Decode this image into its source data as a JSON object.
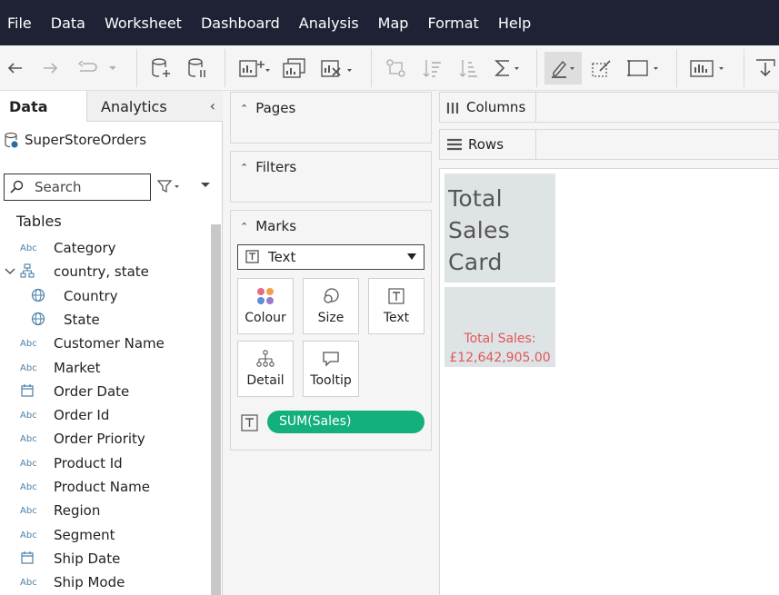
{
  "menubar": {
    "items": [
      "File",
      "Data",
      "Worksheet",
      "Dashboard",
      "Analysis",
      "Map",
      "Format",
      "Help"
    ]
  },
  "toolbar": {
    "icons": [
      "back-arrow-icon",
      "forward-arrow-icon",
      "redo-icon",
      "new-datasource-icon",
      "pause-updates-icon",
      "new-worksheet-icon",
      "duplicate-sheet-icon",
      "clear-sheet-icon",
      "swap-axes-icon",
      "sort-ascending-icon",
      "sort-descending-icon",
      "totals-icon",
      "highlight-icon",
      "annotation-icon",
      "fit-icon",
      "show-me-icon",
      "download-icon"
    ],
    "colors": {
      "menubar_bg": "#1f2235",
      "pill": "#13b07d",
      "value_text": "#e0585b"
    }
  },
  "datapane": {
    "tab_data": "Data",
    "tab_analytics": "Analytics",
    "datasource": "SuperStoreOrders",
    "search_placeholder": "Search",
    "tables_heading": "Tables",
    "fields": [
      {
        "type": "Abc",
        "label": "Category"
      },
      {
        "type": "hier",
        "label": "country, state"
      },
      {
        "type": "geo",
        "label": "Country"
      },
      {
        "type": "geo",
        "label": "State"
      },
      {
        "type": "Abc",
        "label": "Customer Name"
      },
      {
        "type": "Abc",
        "label": "Market"
      },
      {
        "type": "date",
        "label": "Order Date"
      },
      {
        "type": "Abc",
        "label": "Order Id"
      },
      {
        "type": "Abc",
        "label": "Order Priority"
      },
      {
        "type": "Abc",
        "label": "Product Id"
      },
      {
        "type": "Abc",
        "label": "Product Name"
      },
      {
        "type": "Abc",
        "label": "Region"
      },
      {
        "type": "Abc",
        "label": "Segment"
      },
      {
        "type": "date",
        "label": "Ship Date"
      },
      {
        "type": "Abc",
        "label": "Ship Mode"
      }
    ]
  },
  "cards": {
    "pages": "Pages",
    "filters": "Filters",
    "marks": "Marks",
    "mark_type": "Text",
    "buttons": [
      "Colour",
      "Size",
      "Text",
      "Detail",
      "Tooltip"
    ],
    "pill": "SUM(Sales)"
  },
  "view": {
    "columns": "Columns",
    "rows": "Rows",
    "title_lines": [
      "Total",
      "Sales",
      "Card"
    ],
    "value_label": "Total Sales:",
    "value": "£12,642,905.00"
  }
}
